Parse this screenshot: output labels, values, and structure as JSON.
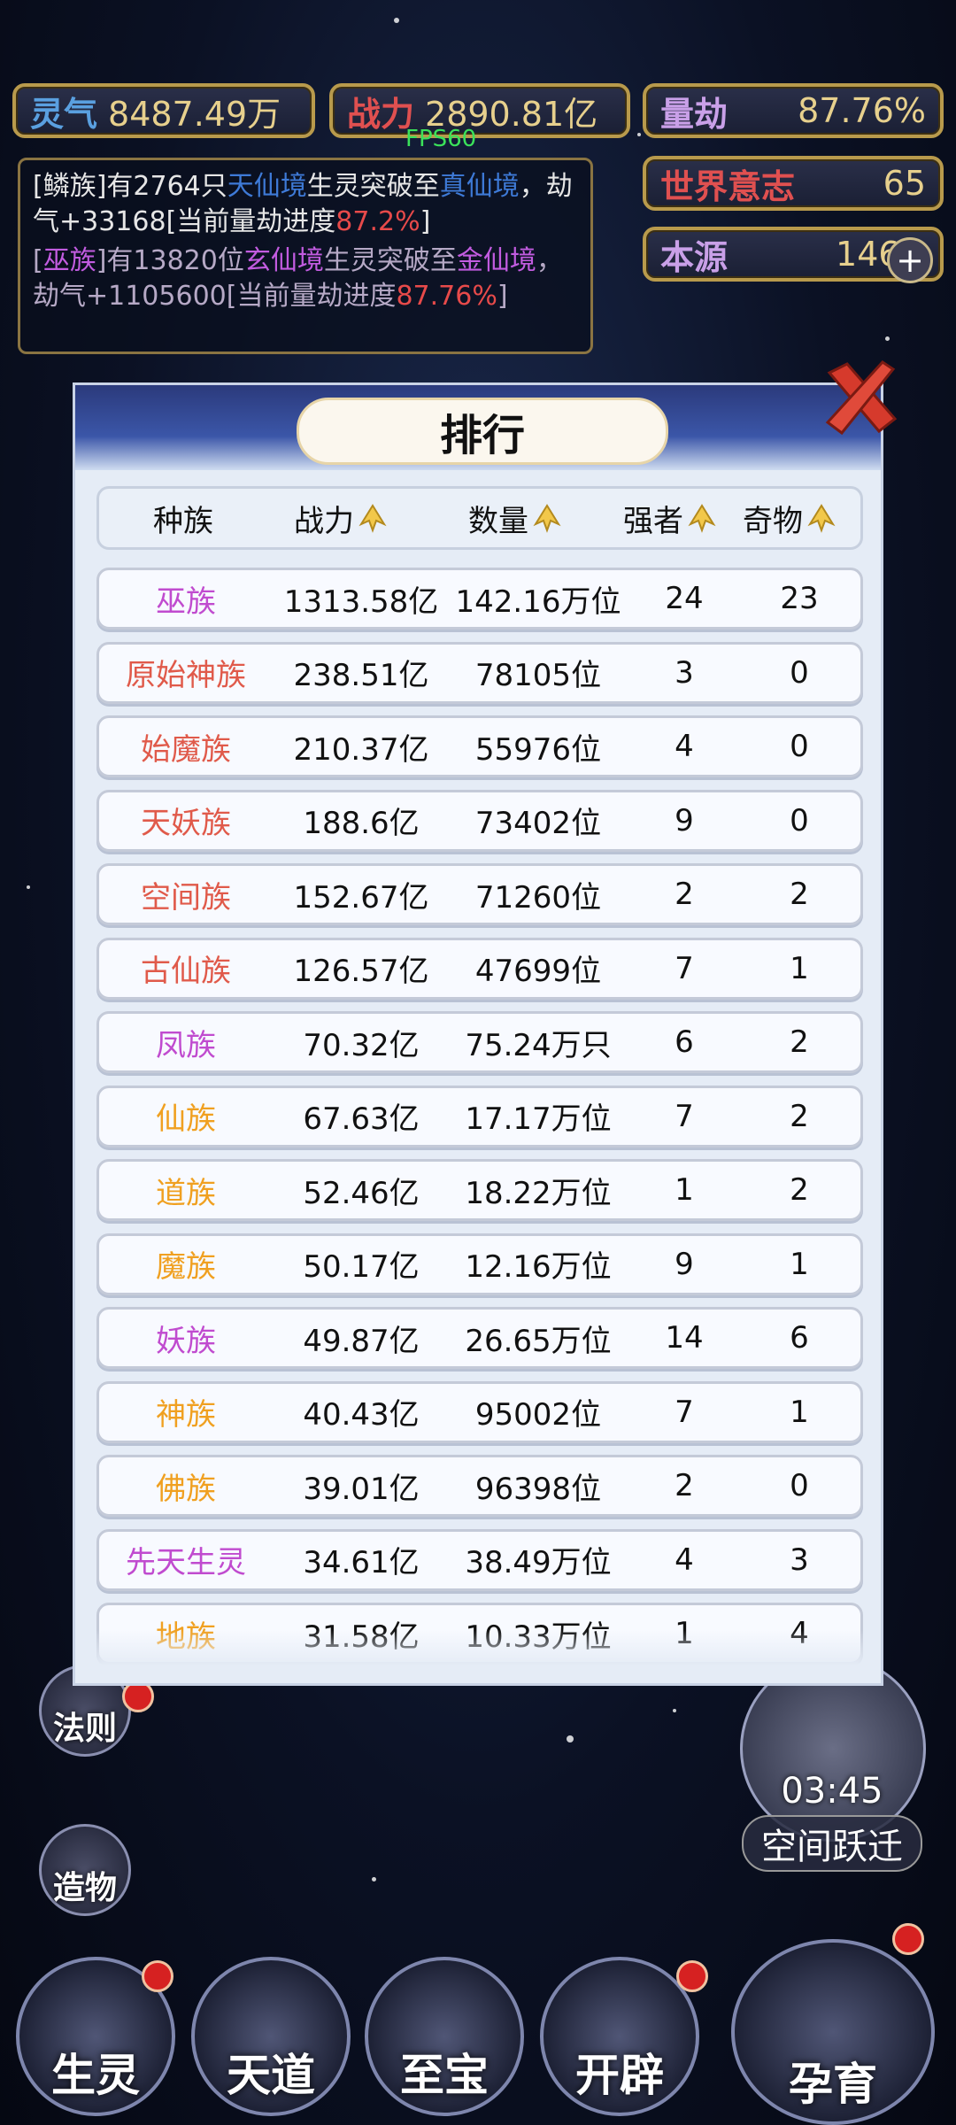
{
  "stats": {
    "lingqi": {
      "label": "灵气",
      "value": "8487.49万"
    },
    "zhanli": {
      "label": "战力",
      "value": "2890.81亿"
    },
    "liangjie": {
      "label": "量劫",
      "value": "87.76%"
    },
    "shijie": {
      "label": "世界意志",
      "value": "65"
    },
    "benyuan": {
      "label": "本源",
      "value": "146"
    }
  },
  "fps": "FPS60",
  "log": {
    "line1_a": "[鳞族]有2764只",
    "line1_b": "天仙境",
    "line1_c": "生灵突破至",
    "line1_d": "真仙境",
    "line1_e": "，劫气+33168[当前量劫进度",
    "line1_f": "87.2%",
    "line1_g": "]",
    "line2_a": "[",
    "line2_b": "巫族",
    "line2_c": "]有13820位",
    "line2_d": "玄仙境",
    "line2_e": "生灵突破至",
    "line2_f": "金仙境",
    "line2_g": "，劫气+1105600[当前量劫进度",
    "line2_h": "87.76%",
    "line2_i": "]"
  },
  "panel": {
    "title": "排行",
    "headers": [
      "种族",
      "战力",
      "数量",
      "强者",
      "奇物"
    ],
    "rows": [
      {
        "race": "巫族",
        "color": "#c04bcf",
        "power": "1313.58亿",
        "count": "142.16万位",
        "strong": "24",
        "items": "23"
      },
      {
        "race": "原始神族",
        "color": "#e05a4a",
        "power": "238.51亿",
        "count": "78105位",
        "strong": "3",
        "items": "0"
      },
      {
        "race": "始魔族",
        "color": "#e05a4a",
        "power": "210.37亿",
        "count": "55976位",
        "strong": "4",
        "items": "0"
      },
      {
        "race": "天妖族",
        "color": "#e05a4a",
        "power": "188.6亿",
        "count": "73402位",
        "strong": "9",
        "items": "0"
      },
      {
        "race": "空间族",
        "color": "#e05a4a",
        "power": "152.67亿",
        "count": "71260位",
        "strong": "2",
        "items": "2"
      },
      {
        "race": "古仙族",
        "color": "#e05a4a",
        "power": "126.57亿",
        "count": "47699位",
        "strong": "7",
        "items": "1"
      },
      {
        "race": "凤族",
        "color": "#c04bcf",
        "power": "70.32亿",
        "count": "75.24万只",
        "strong": "6",
        "items": "2"
      },
      {
        "race": "仙族",
        "color": "#f0a020",
        "power": "67.63亿",
        "count": "17.17万位",
        "strong": "7",
        "items": "2"
      },
      {
        "race": "道族",
        "color": "#f0a020",
        "power": "52.46亿",
        "count": "18.22万位",
        "strong": "1",
        "items": "2"
      },
      {
        "race": "魔族",
        "color": "#f0a020",
        "power": "50.17亿",
        "count": "12.16万位",
        "strong": "9",
        "items": "1"
      },
      {
        "race": "妖族",
        "color": "#c04bcf",
        "power": "49.87亿",
        "count": "26.65万位",
        "strong": "14",
        "items": "6"
      },
      {
        "race": "神族",
        "color": "#f0a020",
        "power": "40.43亿",
        "count": "95002位",
        "strong": "7",
        "items": "1"
      },
      {
        "race": "佛族",
        "color": "#f0a020",
        "power": "39.01亿",
        "count": "96398位",
        "strong": "2",
        "items": "0"
      },
      {
        "race": "先天生灵",
        "color": "#c04bcf",
        "power": "34.61亿",
        "count": "38.49万位",
        "strong": "4",
        "items": "3"
      },
      {
        "race": "地族",
        "color": "#f0a020",
        "power": "31.58亿",
        "count": "10.33万位",
        "strong": "1",
        "items": "4"
      }
    ]
  },
  "side_buttons": {
    "faze": "法则",
    "zaowu": "造物"
  },
  "bottom_buttons": [
    "生灵",
    "天道",
    "至宝",
    "开辟",
    "孕育"
  ],
  "leap": {
    "timer": "03:45",
    "label": "空间跃迁"
  }
}
